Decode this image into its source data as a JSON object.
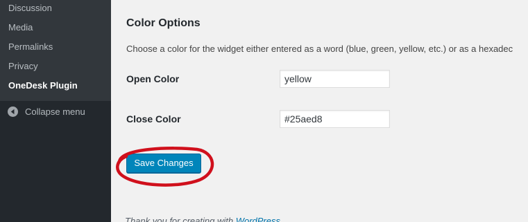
{
  "sidebar": {
    "items": [
      {
        "label": "Discussion"
      },
      {
        "label": "Media"
      },
      {
        "label": "Permalinks"
      },
      {
        "label": "Privacy"
      },
      {
        "label": "OneDesk Plugin",
        "current": true
      }
    ],
    "collapse_label": "Collapse menu",
    "collapse_icon": "collapse-arrow-icon"
  },
  "main": {
    "section_title": "Color Options",
    "description": "Choose a color for the widget either entered as a word (blue, green, yellow, etc.) or as a hexadec",
    "fields": [
      {
        "label": "Open Color",
        "value": "yellow"
      },
      {
        "label": "Close Color",
        "value": "#25aed8"
      }
    ],
    "save_label": "Save Changes"
  },
  "footer": {
    "text": "Thank you for creating with ",
    "link": "WordPress",
    "suffix": "."
  },
  "colors": {
    "sidebar_bg": "#23282d",
    "submenu_bg": "#32373c",
    "content_bg": "#f1f1f1",
    "primary_button": "#0085ba",
    "annotation": "#d0101c"
  }
}
